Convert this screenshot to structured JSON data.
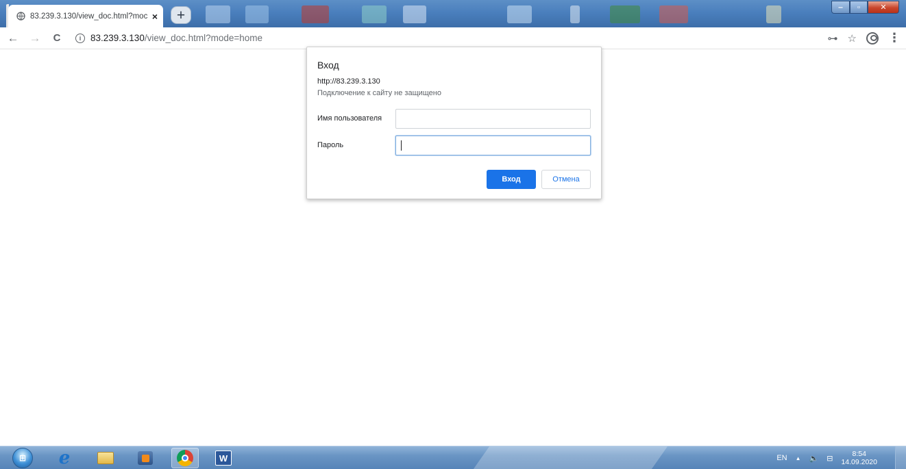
{
  "browser": {
    "tab": {
      "title": "83.239.3.130/view_doc.html?moc",
      "close_glyph": "×",
      "icon": "globe-icon"
    },
    "new_tab_glyph": "+",
    "window_controls": {
      "minimize": "‒",
      "maximize": "▫",
      "close": "✕"
    },
    "toolbar": {
      "back": "←",
      "forward": "→",
      "reload": "C",
      "address": {
        "info_glyph": "i",
        "host": "83.239.3.130",
        "path": "/view_doc.html?mode=home"
      },
      "key_icon": "⊶",
      "star_icon": "☆",
      "menu_icon": "⋮"
    }
  },
  "auth_dialog": {
    "title": "Вход",
    "origin": "http://83.239.3.130",
    "warning": "Подключение к сайту не защищено",
    "username_label": "Имя пользователя",
    "username_value": "",
    "password_label": "Пароль",
    "password_value": "",
    "ok_label": "Вход",
    "cancel_label": "Отмена",
    "accent_color": "#1a73e8"
  },
  "taskbar": {
    "start_icon": "windows-start-icon",
    "pinned": [
      "internet-explorer-icon",
      "file-explorer-icon",
      "media-player-icon",
      "chrome-icon",
      "word-icon"
    ],
    "word_letter": "W",
    "tray": {
      "language": "EN",
      "show_hidden": "▲",
      "volume": "🔈",
      "network": "⊟"
    },
    "clock": {
      "time": "8:54",
      "date": "14.09.2020"
    }
  }
}
